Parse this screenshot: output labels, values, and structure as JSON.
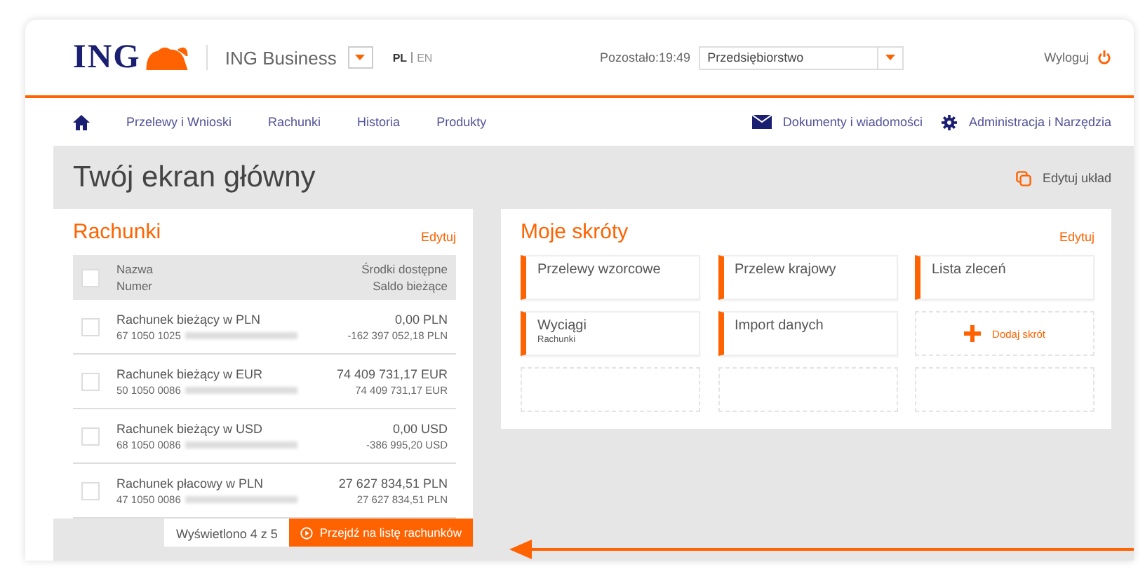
{
  "header": {
    "logo": "ING",
    "product": "ING Business",
    "languages": [
      {
        "label": "PL",
        "selected": true
      },
      {
        "label": "EN",
        "selected": false
      }
    ],
    "session": "Pozostało:19:49",
    "company": "Przedsiębiorstwo",
    "logout": "Wyloguj"
  },
  "nav": {
    "left": [
      {
        "label": "Przelewy i Wnioski"
      },
      {
        "label": "Rachunki"
      },
      {
        "label": "Historia"
      },
      {
        "label": "Produkty"
      }
    ],
    "right": [
      {
        "kind": "mail",
        "label": "Dokumenty i wiadomości"
      },
      {
        "kind": "gear",
        "label": "Administracja i Narzędzia"
      }
    ]
  },
  "page_title": "Twój ekran główny",
  "edit_layout": "Edytuj układ",
  "accounts": {
    "title": "Rachunki",
    "edit": "Edytuj",
    "all_checked": false,
    "columns": {
      "name": "Nazwa",
      "number": "Numer",
      "available": "Środki dostępne",
      "balance": "Saldo bieżące"
    },
    "rows": [
      {
        "name": "Rachunek bieżący w PLN",
        "number": "67 1050 1025",
        "available": "0,00 PLN",
        "balance": "-162 397 052,18 PLN",
        "checked": false
      },
      {
        "name": "Rachunek bieżący w EUR",
        "number": "50 1050 0086",
        "available": "74 409 731,17 EUR",
        "balance": "74 409 731,17 EUR",
        "checked": false
      },
      {
        "name": "Rachunek bieżący w USD",
        "number": "68 1050 0086",
        "available": "0,00 USD",
        "balance": "-386 995,20 USD",
        "checked": false
      },
      {
        "name": "Rachunek płacowy w PLN",
        "number": "47 1050 0086",
        "available": "27 627 834,51 PLN",
        "balance": "27 627 834,51 PLN",
        "checked": false
      }
    ],
    "count": "Wyświetlono 4 z 5",
    "button": "Przejdź na listę rachunków"
  },
  "shortcuts": {
    "title": "Moje skróty",
    "edit": "Edytuj",
    "tiles": [
      {
        "kind": "shortcut",
        "title": "Przelewy wzorcowe"
      },
      {
        "kind": "shortcut",
        "title": "Przelew krajowy"
      },
      {
        "kind": "shortcut",
        "title": "Lista zleceń"
      },
      {
        "kind": "shortcut",
        "title": "Wyciągi",
        "subtitle": "Rachunki"
      },
      {
        "kind": "shortcut",
        "title": "Import danych"
      },
      {
        "kind": "add",
        "label": "Dodaj skrót"
      },
      {
        "kind": "empty"
      },
      {
        "kind": "empty"
      },
      {
        "kind": "empty"
      }
    ]
  }
}
